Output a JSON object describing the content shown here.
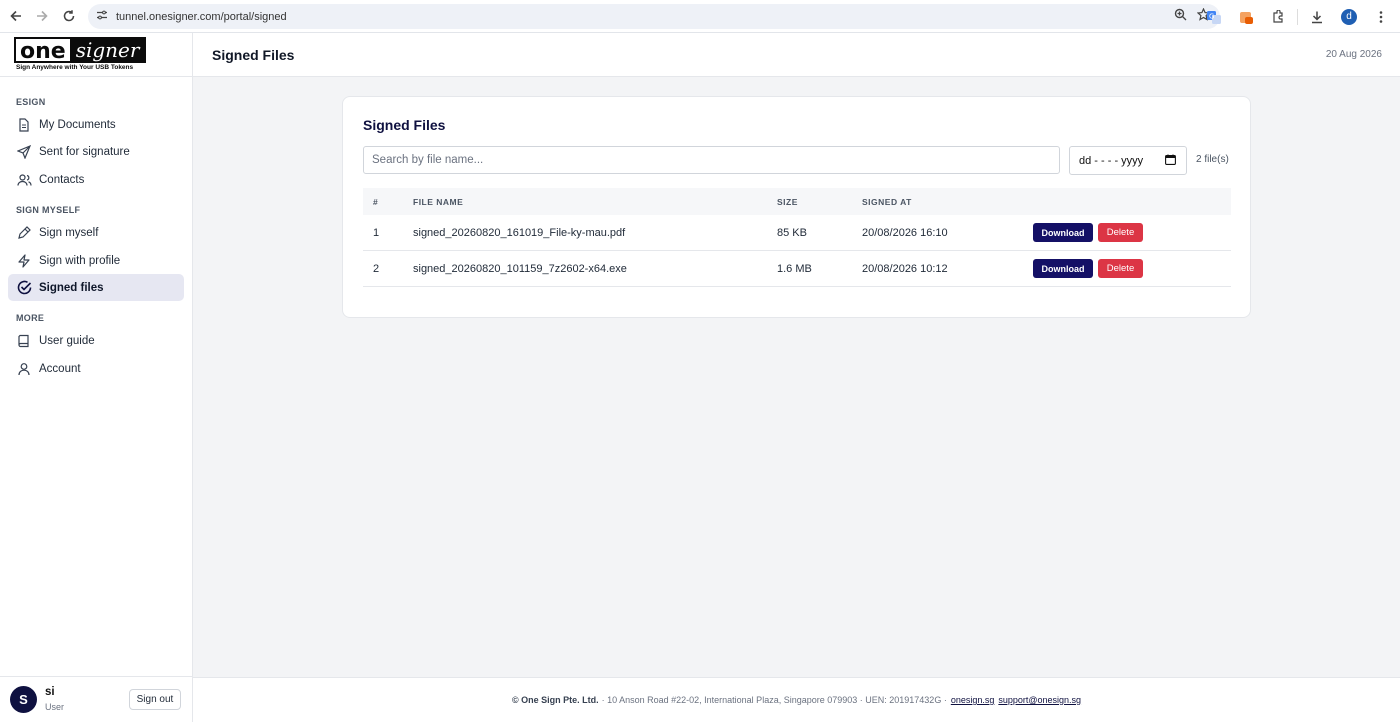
{
  "browser": {
    "url": "tunnel.onesigner.com/portal/signed",
    "profile_initial": "d"
  },
  "logo": {
    "one": "one",
    "signer": "signer",
    "tagline": "Sign Anywhere with Your USB Tokens"
  },
  "sidebar": {
    "sections": [
      {
        "label": "ESIGN",
        "items": [
          {
            "label": "My Documents",
            "icon": "document-icon"
          },
          {
            "label": "Sent for signature",
            "icon": "send-icon"
          },
          {
            "label": "Contacts",
            "icon": "contacts-icon"
          }
        ]
      },
      {
        "label": "SIGN MYSELF",
        "items": [
          {
            "label": "Sign myself",
            "icon": "pen-icon"
          },
          {
            "label": "Sign with profile",
            "icon": "lightning-icon"
          },
          {
            "label": "Signed files",
            "icon": "check-circle-icon",
            "active": true
          }
        ]
      },
      {
        "label": "MORE",
        "items": [
          {
            "label": "User guide",
            "icon": "book-icon"
          },
          {
            "label": "Account",
            "icon": "user-icon"
          }
        ]
      }
    ],
    "user": {
      "initial": "S",
      "name": "si",
      "role": "User",
      "signout_label": "Sign out"
    }
  },
  "header": {
    "title": "Signed Files",
    "date": "20 Aug 2026"
  },
  "card": {
    "title": "Signed Files",
    "search_placeholder": "Search by file name...",
    "date_placeholder": "dd - - - - yyyy",
    "count": "2 file(s)",
    "columns": [
      "#",
      "FILE NAME",
      "SIZE",
      "SIGNED AT"
    ],
    "rows": [
      {
        "num": "1",
        "file_name": "signed_20260820_161019_File-ky-mau.pdf",
        "size": "85 KB",
        "signed_at": "20/08/2026 16:10",
        "download_label": "Download",
        "delete_label": "Delete"
      },
      {
        "num": "2",
        "file_name": "signed_20260820_101159_7z2602-x64.exe",
        "size": "1.6 MB",
        "signed_at": "20/08/2026 10:12",
        "download_label": "Download",
        "delete_label": "Delete"
      }
    ]
  },
  "footer": {
    "company": "© One Sign Pte. Ltd.",
    "address": "· 10 Anson Road #22-02, International Plaza, Singapore 079903 · UEN: 201917432G ·",
    "link1": "onesign.sg",
    "link2": "support@onesign.sg"
  },
  "colors": {
    "brand": "#0f1140",
    "download": "#141066",
    "delete": "#dc3545",
    "active_bg": "#e6e7f2"
  }
}
